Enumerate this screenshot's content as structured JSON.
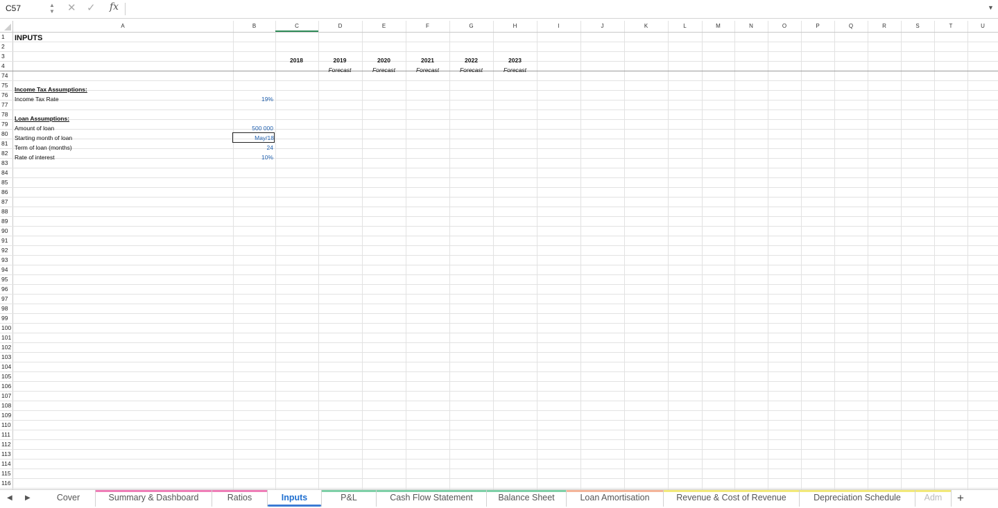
{
  "formula_bar": {
    "name_box": "C57",
    "cancel_icon": "✕",
    "confirm_icon": "✓",
    "fx_label": "fx",
    "formula": ""
  },
  "columns": [
    "A",
    "B",
    "C",
    "D",
    "E",
    "F",
    "G",
    "H",
    "I",
    "J",
    "K",
    "L",
    "M",
    "N",
    "O",
    "P",
    "Q",
    "R",
    "S",
    "T",
    "U"
  ],
  "rows": [
    "1",
    "2",
    "3",
    "4",
    "74",
    "75",
    "76",
    "77",
    "78",
    "79",
    "80",
    "81",
    "82",
    "83",
    "84",
    "85",
    "86",
    "87",
    "88",
    "89",
    "90",
    "91",
    "92",
    "93",
    "94",
    "95",
    "96",
    "97",
    "98",
    "99",
    "100",
    "101",
    "102",
    "103",
    "104",
    "105",
    "106",
    "107",
    "108",
    "109",
    "110",
    "111",
    "112",
    "113",
    "114",
    "115",
    "116"
  ],
  "sheet": {
    "title": "INPUTS",
    "years": [
      "2018",
      "2019",
      "2020",
      "2021",
      "2022",
      "2023"
    ],
    "forecast_label": "Forecast",
    "income_tax_header": "Income Tax Assumptions:",
    "income_tax_rate_label": "Income Tax Rate",
    "income_tax_rate_value": "19%",
    "loan_header": "Loan Assumptions:",
    "loan_amount_label": "Amount of loan",
    "loan_amount_value": "500 000",
    "loan_start_label": "Starting month of loan",
    "loan_start_value": "May/18",
    "loan_term_label": "Term of loan (months)",
    "loan_term_value": "24",
    "loan_rate_label": "Rate of interest",
    "loan_rate_value": "10%"
  },
  "tabs": [
    {
      "label": "Cover",
      "color": ""
    },
    {
      "label": "Summary & Dashboard",
      "color": "#f07fb8"
    },
    {
      "label": "Ratios",
      "color": "#f07fb8"
    },
    {
      "label": "Inputs",
      "color": "#5b8fd6"
    },
    {
      "label": "P&L",
      "color": "#7fd1a8"
    },
    {
      "label": "Cash Flow Statement",
      "color": "#7fd1a8"
    },
    {
      "label": "Balance Sheet",
      "color": "#7fd1a8"
    },
    {
      "label": "Loan Amortisation",
      "color": "#f5b59a"
    },
    {
      "label": "Revenue & Cost of Revenue",
      "color": "#f3ea7a"
    },
    {
      "label": "Depreciation Schedule",
      "color": "#f3ea7a"
    },
    {
      "label": "Adm",
      "color": "#f3ea7a"
    }
  ],
  "active_tab": "Inputs",
  "add_sheet_label": "+"
}
